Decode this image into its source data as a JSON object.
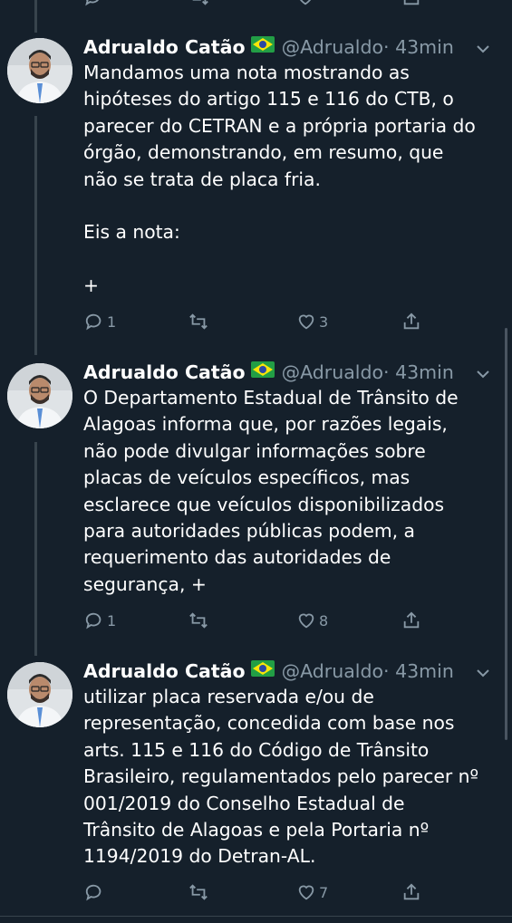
{
  "tweets": [
    {
      "name": "Adrualdo Catão",
      "handle": "@Adrualdo",
      "time": "· 43min",
      "text": "Mandamos uma nota mostrando as\nhipóteses do artigo 115 e 116 do CTB, o\nparecer do CETRAN e a própria portaria do\nórgão, demonstrando, em resumo, que\nnão se trata de placa fria.\n\nEis a nota:\n\n+",
      "replies": "1",
      "retweets": "",
      "likes": "3"
    },
    {
      "name": "Adrualdo Catão",
      "handle": "@Adrualdo",
      "time": "· 43min",
      "text": "O Departamento Estadual de Trânsito de\nAlagoas informa que, por razões legais,\nnão pode divulgar informações sobre\nplacas de veículos específicos, mas\nesclarece que veículos disponibilizados\npara autoridades públicas podem, a\nrequerimento das autoridades de\nsegurança, +",
      "replies": "1",
      "retweets": "",
      "likes": "8"
    },
    {
      "name": "Adrualdo Catão",
      "handle": "@Adrualdo",
      "time": "· 43min",
      "text": "utilizar placa reservada e/ou de\nrepresentação, concedida com base nos\narts. 115 e 116 do Código de Trânsito\nBrasileiro, regulamentados pelo parecer nº\n001/2019 do Conselho Estadual de\nTrânsito de Alagoas e pela Portaria nº\n1194/2019 do Detran-AL.",
      "replies": "",
      "retweets": "",
      "likes": "7"
    }
  ],
  "icons": {
    "reply": "reply-icon",
    "retweet": "retweet-icon",
    "like": "heart-icon",
    "share": "share-icon",
    "menu": "chevron-down-icon",
    "flag": "brazil-flag-icon"
  },
  "colors": {
    "background": "#15202b",
    "text": "#ffffff",
    "muted": "#8899a6",
    "thread_line": "#38444d"
  }
}
